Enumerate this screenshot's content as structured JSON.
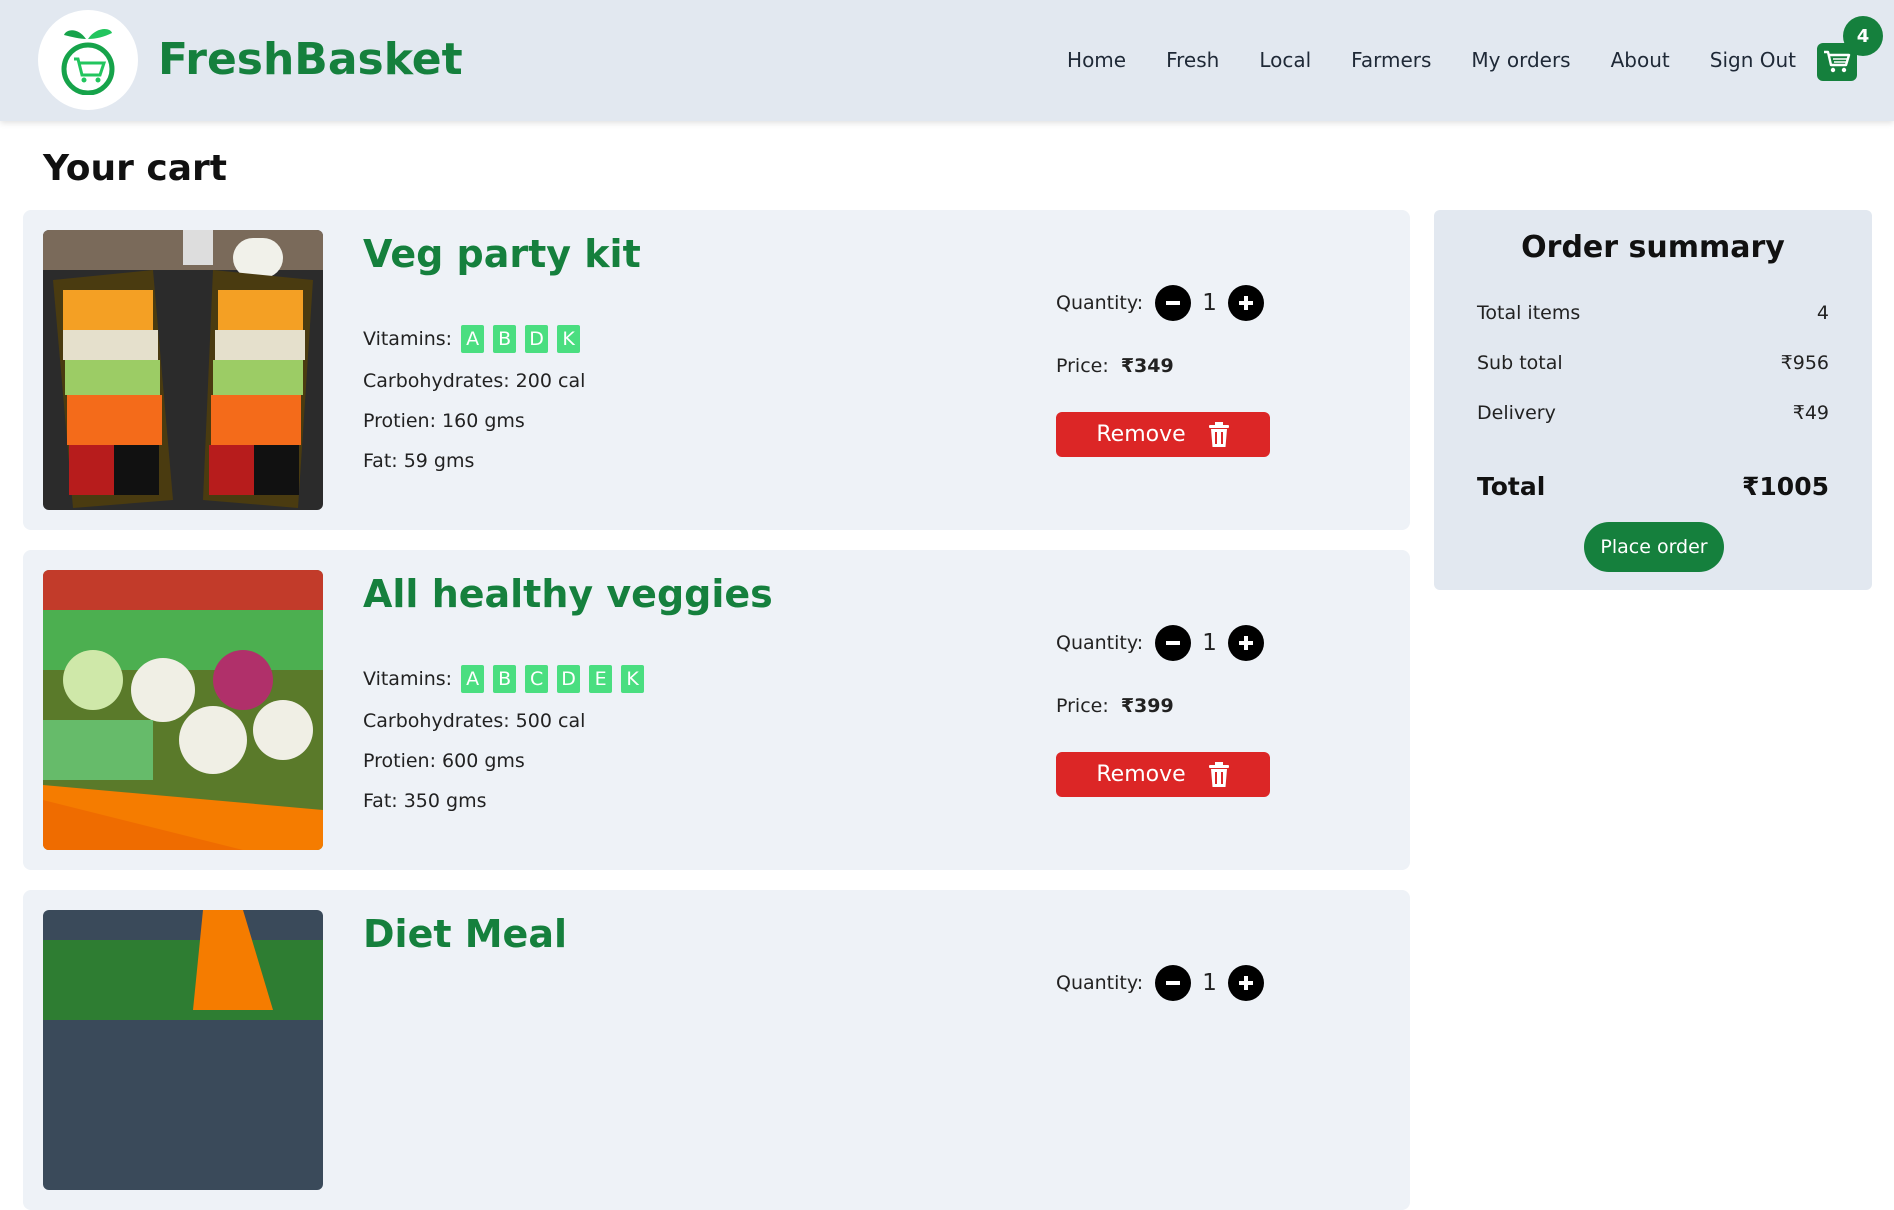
{
  "brand": {
    "name": "FreshBasket"
  },
  "nav": [
    "Home",
    "Fresh",
    "Local",
    "Farmers",
    "My orders",
    "About",
    "Sign Out"
  ],
  "cart": {
    "count": "4",
    "icon": "cart-icon"
  },
  "page": {
    "title": "Your cart"
  },
  "labels": {
    "vitamins": "Vitamins:",
    "quantity": "Quantity:",
    "price": "Price:",
    "remove": "Remove"
  },
  "items": [
    {
      "name": "Veg party kit",
      "vitamins": [
        "A",
        "B",
        "D",
        "K"
      ],
      "carbs": "Carbohydrates: 200 cal",
      "protein": "Protien: 160 gms",
      "fat": "Fat: 59 gms",
      "quantity": "1",
      "price": "₹349"
    },
    {
      "name": "All healthy veggies",
      "vitamins": [
        "A",
        "B",
        "C",
        "D",
        "E",
        "K"
      ],
      "carbs": "Carbohydrates: 500 cal",
      "protein": "Protien: 600 gms",
      "fat": "Fat: 350 gms",
      "quantity": "1",
      "price": "₹399"
    },
    {
      "name": "Diet Meal",
      "quantity": "1"
    }
  ],
  "summary": {
    "title": "Order summary",
    "rows": [
      {
        "label": "Total items",
        "value": "4"
      },
      {
        "label": "Sub total",
        "value": "₹956"
      },
      {
        "label": "Delivery",
        "value": "₹49"
      }
    ],
    "total_label": "Total",
    "total_value": "₹1005",
    "place_order": "Place order"
  },
  "colors": {
    "brand_green": "#15803d",
    "vitamin_green": "#4ade80",
    "remove_red": "#dc2626",
    "header_bg": "#e2e8f0",
    "card_bg": "#eef2f7"
  }
}
